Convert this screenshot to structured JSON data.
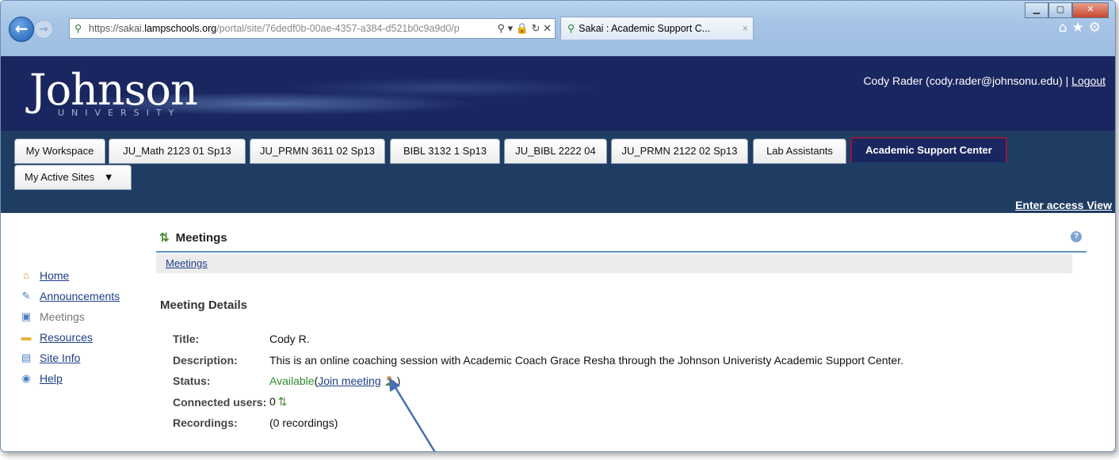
{
  "browser": {
    "url_prefix": "https://sakai.",
    "url_domain": "lampschools.org",
    "url_rest": "/portal/site/76dedf0b-00ae-4357-a384-d521b0c9a9d0/p",
    "tab_title": "Sakai : Academic Support C..."
  },
  "header": {
    "logo_main": "Johnson",
    "logo_sub": "UNIVERSITY",
    "user_text": "Cody Rader (cody.rader@johnsonu.edu)",
    "separator": "|",
    "logout": "Logout"
  },
  "site_tabs": [
    "My Workspace",
    "JU_Math 2123 01 Sp13",
    "JU_PRMN 3611 02 Sp13",
    "BIBL 3132 1 Sp13",
    "JU_BIBL 2222 04",
    "JU_PRMN 2122 02 Sp13",
    "Lab Assistants",
    "Academic Support Center"
  ],
  "active_sites_label": "My Active Sites",
  "enter_access": "Enter access View",
  "left_nav": [
    {
      "label": "Home",
      "icon": "house-icon"
    },
    {
      "label": "Announcements",
      "icon": "megaphone-icon"
    },
    {
      "label": "Meetings",
      "icon": "meeting-icon"
    },
    {
      "label": "Resources",
      "icon": "folder-icon"
    },
    {
      "label": "Site Info",
      "icon": "site-info-icon"
    },
    {
      "label": "Help",
      "icon": "help-icon"
    }
  ],
  "tool": {
    "title": "Meetings",
    "breadcrumb": "Meetings",
    "section_title": "Meeting Details"
  },
  "details": {
    "title_label": "Title:",
    "title_value": "Cody R.",
    "description_label": "Description:",
    "description_value": "This is an online coaching session with Academic Coach Grace Resha through the Johnson Univeristy Academic Support Center.",
    "status_label": "Status:",
    "status_value": "Available",
    "join_label": "Join meeting",
    "connected_label": "Connected users:",
    "connected_value": "0",
    "recordings_label": "Recordings:",
    "recordings_value": "(0 recordings)"
  },
  "colors": {
    "header_bg": "#1a2660",
    "tabbar_bg": "#1f3c63",
    "link": "#1d3e8a",
    "available": "#2f8c2f",
    "arrow": "#4a6fb0"
  }
}
